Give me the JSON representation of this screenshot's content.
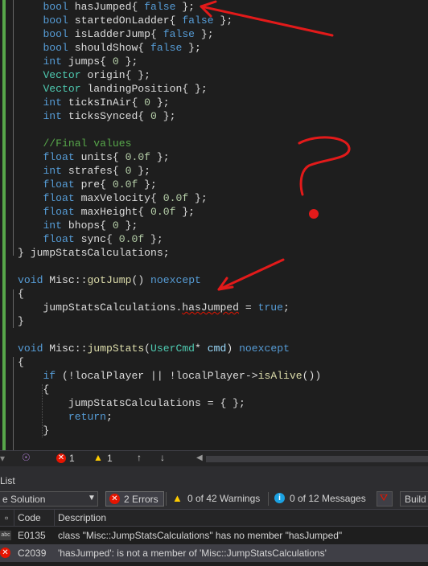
{
  "code_lines": [
    {
      "tokens": [
        {
          "t": "    "
        },
        {
          "t": "bool",
          "c": "kw"
        },
        {
          "t": " hasJumped{ "
        },
        {
          "t": "false",
          "c": "kw"
        },
        {
          "t": " };"
        }
      ]
    },
    {
      "tokens": [
        {
          "t": "    "
        },
        {
          "t": "bool",
          "c": "kw"
        },
        {
          "t": " startedOnLadder{ "
        },
        {
          "t": "false",
          "c": "kw"
        },
        {
          "t": " };"
        }
      ]
    },
    {
      "tokens": [
        {
          "t": "    "
        },
        {
          "t": "bool",
          "c": "kw"
        },
        {
          "t": " isLadderJump{ "
        },
        {
          "t": "false",
          "c": "kw"
        },
        {
          "t": " };"
        }
      ]
    },
    {
      "tokens": [
        {
          "t": "    "
        },
        {
          "t": "bool",
          "c": "kw"
        },
        {
          "t": " shouldShow{ "
        },
        {
          "t": "false",
          "c": "kw"
        },
        {
          "t": " };"
        }
      ]
    },
    {
      "tokens": [
        {
          "t": "    "
        },
        {
          "t": "int",
          "c": "kw"
        },
        {
          "t": " jumps{ "
        },
        {
          "t": "0",
          "c": "num"
        },
        {
          "t": " };"
        }
      ]
    },
    {
      "tokens": [
        {
          "t": "    "
        },
        {
          "t": "Vector",
          "c": "ty"
        },
        {
          "t": " origin{ };"
        }
      ]
    },
    {
      "tokens": [
        {
          "t": "    "
        },
        {
          "t": "Vector",
          "c": "ty"
        },
        {
          "t": " landingPosition{ };"
        }
      ]
    },
    {
      "tokens": [
        {
          "t": "    "
        },
        {
          "t": "int",
          "c": "kw"
        },
        {
          "t": " ticksInAir{ "
        },
        {
          "t": "0",
          "c": "num"
        },
        {
          "t": " };"
        }
      ]
    },
    {
      "tokens": [
        {
          "t": "    "
        },
        {
          "t": "int",
          "c": "kw"
        },
        {
          "t": " ticksSynced{ "
        },
        {
          "t": "0",
          "c": "num"
        },
        {
          "t": " };"
        }
      ]
    },
    {
      "tokens": []
    },
    {
      "tokens": [
        {
          "t": "    "
        },
        {
          "t": "//Final values",
          "c": "cm"
        }
      ]
    },
    {
      "tokens": [
        {
          "t": "    "
        },
        {
          "t": "float",
          "c": "kw"
        },
        {
          "t": " units{ "
        },
        {
          "t": "0.0f",
          "c": "num"
        },
        {
          "t": " };"
        }
      ]
    },
    {
      "tokens": [
        {
          "t": "    "
        },
        {
          "t": "int",
          "c": "kw"
        },
        {
          "t": " strafes{ "
        },
        {
          "t": "0",
          "c": "num"
        },
        {
          "t": " };"
        }
      ]
    },
    {
      "tokens": [
        {
          "t": "    "
        },
        {
          "t": "float",
          "c": "kw"
        },
        {
          "t": " pre{ "
        },
        {
          "t": "0.0f",
          "c": "num"
        },
        {
          "t": " };"
        }
      ]
    },
    {
      "tokens": [
        {
          "t": "    "
        },
        {
          "t": "float",
          "c": "kw"
        },
        {
          "t": " maxVelocity{ "
        },
        {
          "t": "0.0f",
          "c": "num"
        },
        {
          "t": " };"
        }
      ]
    },
    {
      "tokens": [
        {
          "t": "    "
        },
        {
          "t": "float",
          "c": "kw"
        },
        {
          "t": " maxHeight{ "
        },
        {
          "t": "0.0f",
          "c": "num"
        },
        {
          "t": " };"
        }
      ]
    },
    {
      "tokens": [
        {
          "t": "    "
        },
        {
          "t": "int",
          "c": "kw"
        },
        {
          "t": " bhops{ "
        },
        {
          "t": "0",
          "c": "num"
        },
        {
          "t": " };"
        }
      ]
    },
    {
      "tokens": [
        {
          "t": "    "
        },
        {
          "t": "float",
          "c": "kw"
        },
        {
          "t": " sync{ "
        },
        {
          "t": "0.0f",
          "c": "num"
        },
        {
          "t": " };"
        }
      ]
    },
    {
      "tokens": [
        {
          "t": "} jumpStatsCalculations;"
        }
      ]
    },
    {
      "tokens": []
    },
    {
      "tokens": [
        {
          "t": "void",
          "c": "kw"
        },
        {
          "t": " Misc::"
        },
        {
          "t": "gotJump",
          "c": "fn"
        },
        {
          "t": "() "
        },
        {
          "t": "noexcept",
          "c": "kw"
        }
      ]
    },
    {
      "tokens": [
        {
          "t": "{"
        }
      ]
    },
    {
      "tokens": [
        {
          "t": "    jumpStatsCalculations."
        },
        {
          "t": "hasJumped",
          "c": "err"
        },
        {
          "t": " = "
        },
        {
          "t": "true",
          "c": "kw"
        },
        {
          "t": ";"
        }
      ]
    },
    {
      "tokens": [
        {
          "t": "}"
        }
      ]
    },
    {
      "tokens": []
    },
    {
      "tokens": [
        {
          "t": "void",
          "c": "kw"
        },
        {
          "t": " Misc::"
        },
        {
          "t": "jumpStats",
          "c": "fn"
        },
        {
          "t": "("
        },
        {
          "t": "UserCmd",
          "c": "ty"
        },
        {
          "t": "* "
        },
        {
          "t": "cmd",
          "c": "var"
        },
        {
          "t": ") "
        },
        {
          "t": "noexcept",
          "c": "kw"
        }
      ]
    },
    {
      "tokens": [
        {
          "t": "{"
        }
      ]
    },
    {
      "tokens": [
        {
          "t": "    "
        },
        {
          "t": "if",
          "c": "kw"
        },
        {
          "t": " (!localPlayer || !localPlayer->"
        },
        {
          "t": "isAlive",
          "c": "fn"
        },
        {
          "t": "())"
        }
      ]
    },
    {
      "tokens": [
        {
          "t": "    {"
        }
      ]
    },
    {
      "tokens": [
        {
          "t": "        jumpStatsCalculations = { };"
        }
      ]
    },
    {
      "tokens": [
        {
          "t": "        "
        },
        {
          "t": "return",
          "c": "kw"
        },
        {
          "t": ";"
        }
      ]
    },
    {
      "tokens": [
        {
          "t": "    }"
        }
      ]
    }
  ],
  "status": {
    "errors": "1",
    "warnings": "1"
  },
  "panel": {
    "title": "List",
    "scope": "e Solution",
    "errors_label": "2 Errors",
    "warnings_label": "0 of 42 Warnings",
    "messages_label": "0 of 12 Messages",
    "build_label": "Build"
  },
  "columns": {
    "code": "Code",
    "description": "Description"
  },
  "rows": [
    {
      "code": "E0135",
      "description": "class \"Misc::JumpStatsCalculations\" has no member \"hasJumped\""
    },
    {
      "code": "C2039",
      "description": "'hasJumped': is not a member of 'Misc::JumpStatsCalculations'"
    }
  ],
  "colors": {
    "error": "#e51400",
    "warning": "#ffcc00",
    "annotation": "#e21a1a"
  }
}
